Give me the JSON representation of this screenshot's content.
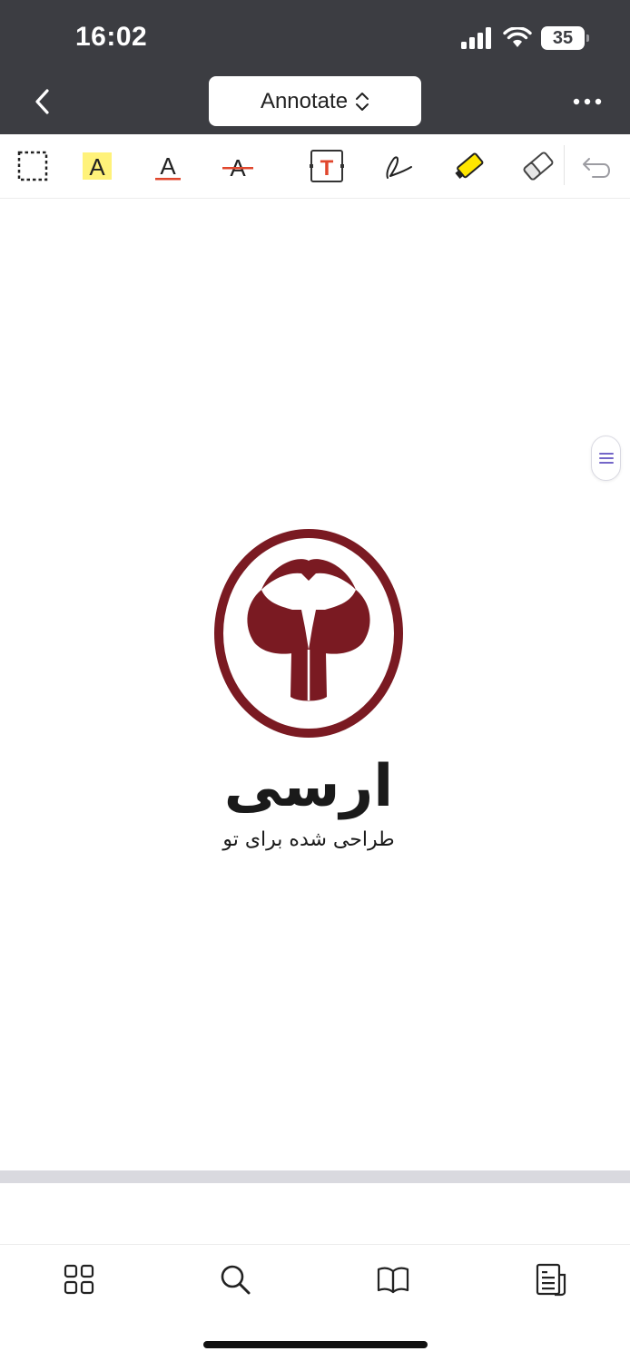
{
  "status_bar": {
    "time": "16:02",
    "battery": "35"
  },
  "header": {
    "mode_label": "Annotate"
  },
  "toolbar": {
    "tools": [
      {
        "name": "select-tool",
        "glyph": ""
      },
      {
        "name": "highlight-text-tool",
        "glyph": "A"
      },
      {
        "name": "underline-text-tool",
        "glyph": "A"
      },
      {
        "name": "strikethrough-text-tool",
        "glyph": "A"
      },
      {
        "name": "text-box-tool",
        "glyph": "T"
      },
      {
        "name": "pen-tool",
        "glyph": ""
      },
      {
        "name": "highlighter-tool",
        "glyph": ""
      },
      {
        "name": "eraser-tool",
        "glyph": ""
      },
      {
        "name": "undo-tool",
        "glyph": ""
      }
    ]
  },
  "document": {
    "logo_title": "ارسی",
    "logo_tagline": "طراحی شده برای تو"
  },
  "colors": {
    "topbar": "#3c3d42",
    "brand": "#7a1a22",
    "accent_red": "#e0462c",
    "highlight_yellow": "#fff27a",
    "handle_purple": "#7466c8"
  }
}
